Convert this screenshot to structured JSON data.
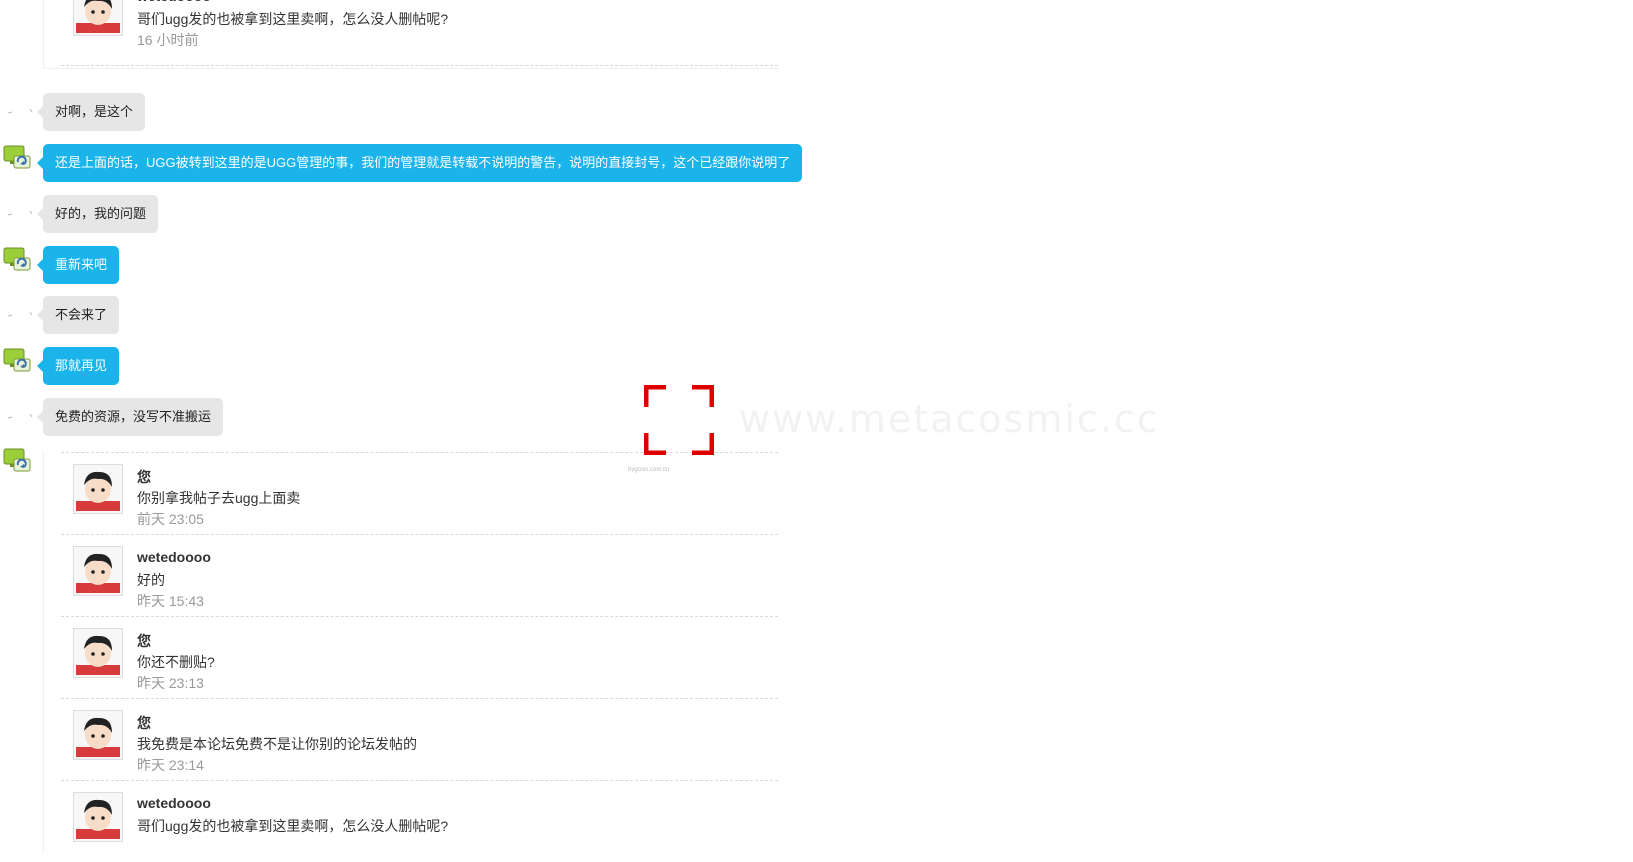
{
  "top_quote": {
    "entries": [
      {
        "name": "wetedoooo",
        "text": "哥们ugg发的也被拿到这里卖啊，怎么没人删帖呢?",
        "time": "16 小时前"
      }
    ]
  },
  "messages": [
    {
      "side": "user",
      "color": "gray",
      "text": "对啊，是这个"
    },
    {
      "side": "system",
      "color": "blue",
      "text": "还是上面的话，UGG被转到这里的是UGG管理的事，我们的管理就是转载不说明的警告，说明的直接封号，这个已经跟你说明了"
    },
    {
      "side": "user",
      "color": "gray",
      "text": "好的，我的问题"
    },
    {
      "side": "system",
      "color": "blue",
      "text": "重新来吧"
    },
    {
      "side": "user",
      "color": "gray",
      "text": "不会来了"
    },
    {
      "side": "system",
      "color": "blue",
      "text": "那就再见"
    },
    {
      "side": "user",
      "color": "gray",
      "text": "免费的资源，没写不准搬运"
    }
  ],
  "bottom_quote": {
    "entries": [
      {
        "name": "您",
        "text": "你别拿我帖子去ugg上面卖",
        "time": "前天 23:05"
      },
      {
        "name": "wetedoooo",
        "text": "好的",
        "time": "昨天 15:43"
      },
      {
        "name": "您",
        "text": "你还不删贴?",
        "time": "昨天 23:13"
      },
      {
        "name": "您",
        "text": "我免费是本论坛免费不是让你别的论坛发帖的",
        "time": "昨天 23:14"
      },
      {
        "name": "wetedoooo",
        "text": "哥们ugg发的也被拿到这里卖啊，怎么没人删帖呢?",
        "time": ""
      }
    ]
  },
  "watermark": {
    "text": "www.metacosmic.cc",
    "small": "bygosis.com.cn"
  },
  "icons": {
    "avatar": "cartoon-avatar-icon",
    "system_avatar": "refresh-monitor-icon",
    "focus": "focus-corners-icon"
  },
  "colors": {
    "blue_bubble": "#1ab3ea",
    "gray_bubble": "#e6e6e6",
    "focus_red": "#dd0000"
  }
}
